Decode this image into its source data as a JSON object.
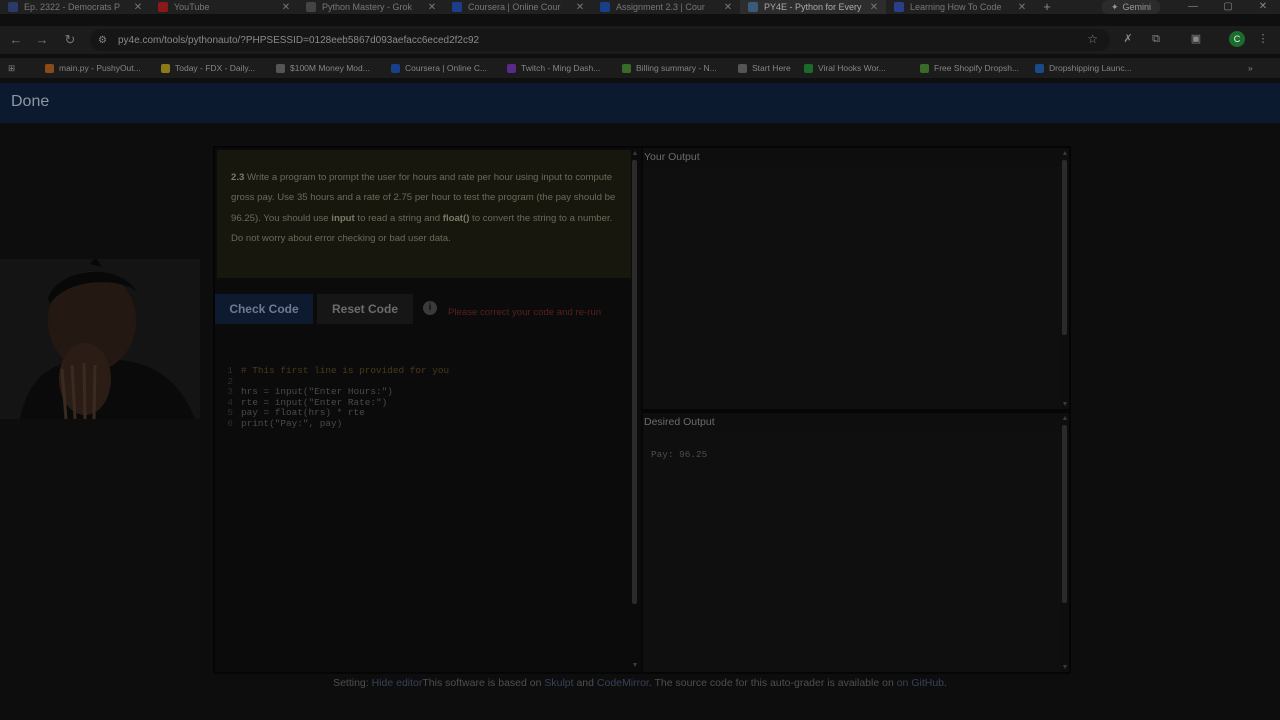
{
  "tabs": [
    {
      "title": "Ep. 2322 - Democrats P",
      "icon": "dw-icon",
      "color": "#2a3b6a"
    },
    {
      "title": "YouTube",
      "icon": "youtube-icon",
      "color": "#8a1a1a"
    },
    {
      "title": "Python Mastery - Grok",
      "icon": "grok-icon",
      "color": "#444444"
    },
    {
      "title": "Coursera | Online Cour",
      "icon": "coursera-icon",
      "color": "#1a3f8a"
    },
    {
      "title": "Assignment 2.3 | Cour",
      "icon": "coursera-icon",
      "color": "#1a3f8a"
    },
    {
      "title": "PY4E - Python for Every",
      "icon": "python-icon",
      "color": "#3a5a7a"
    },
    {
      "title": "Learning How To Code",
      "icon": "learn-icon",
      "color": "#2a3f8a"
    }
  ],
  "gemini_label": "Gemini",
  "address": {
    "url": "py4e.com/tools/pythonauto/?PHPSESSID=0128eeb5867d093aefacc6eced2f2c92"
  },
  "bookmarks": [
    {
      "label": "main.py - PushyOut...",
      "icon": "repl-icon",
      "color": "#8a4a1a"
    },
    {
      "label": "Today - FDX - Daily...",
      "icon": "folder-icon",
      "color": "#8a7a1a"
    },
    {
      "label": "$100M Money Mod...",
      "icon": "person-icon",
      "color": "#555555"
    },
    {
      "label": "Coursera | Online C...",
      "icon": "coursera-icon",
      "color": "#1a3f8a"
    },
    {
      "label": "Twitch - Ming Dash...",
      "icon": "twitch-icon",
      "color": "#5a2a8a"
    },
    {
      "label": "Billing summary - N...",
      "icon": "billing-icon",
      "color": "#3a6a2a"
    },
    {
      "label": "Start Here",
      "icon": "triangle-icon",
      "color": "#555555"
    },
    {
      "label": "Viral Hooks Wor...",
      "icon": "sheets-icon",
      "color": "#1a6a2a"
    },
    {
      "label": "Free Shopify Dropsh...",
      "icon": "shopify-icon",
      "color": "#3a6a2a"
    },
    {
      "label": "Dropshipping Launc...",
      "icon": "bookmark-icon",
      "color": "#1a4a8a"
    }
  ],
  "page": {
    "done_label": "Done",
    "prompt": {
      "number": "2.3",
      "part1": " Write a program to prompt the user for hours and rate per hour using input to compute gross pay. Use 35 hours and a rate of 2.75 per hour to test the program (the pay should be 96.25). You should use ",
      "kw_input": "input",
      "part2": " to read a string and ",
      "kw_float": "float()",
      "part3": " to convert the string to a number. Do not worry about error checking or bad user data."
    },
    "check_button": "Check Code",
    "reset_button": "Reset Code",
    "error_message": "Please correct your code and re-run",
    "code_lines": [
      {
        "num": "1",
        "text": "# This first line is provided for you"
      },
      {
        "num": "2",
        "text": ""
      },
      {
        "num": "3",
        "text": "hrs = input(\"Enter Hours:\")"
      },
      {
        "num": "4",
        "text": "rte = input(\"Enter Rate:\")"
      },
      {
        "num": "5",
        "text": "pay = float(hrs) * rte"
      },
      {
        "num": "6",
        "text": "print(\"Pay:\", pay)"
      }
    ],
    "your_output_title": "Your Output",
    "desired_output_title": "Desired Output",
    "desired_output_value": "Pay: 96.25",
    "footer": {
      "setting": "Setting: ",
      "hide_editor": "Hide editor",
      "text1": "This software is based on ",
      "skulpt": "Skulpt",
      "and": " and ",
      "codemirror": "CodeMirror",
      "text2": ". The source code for this auto-grader is available on ",
      "github": "on GitHub",
      "end": "."
    }
  }
}
